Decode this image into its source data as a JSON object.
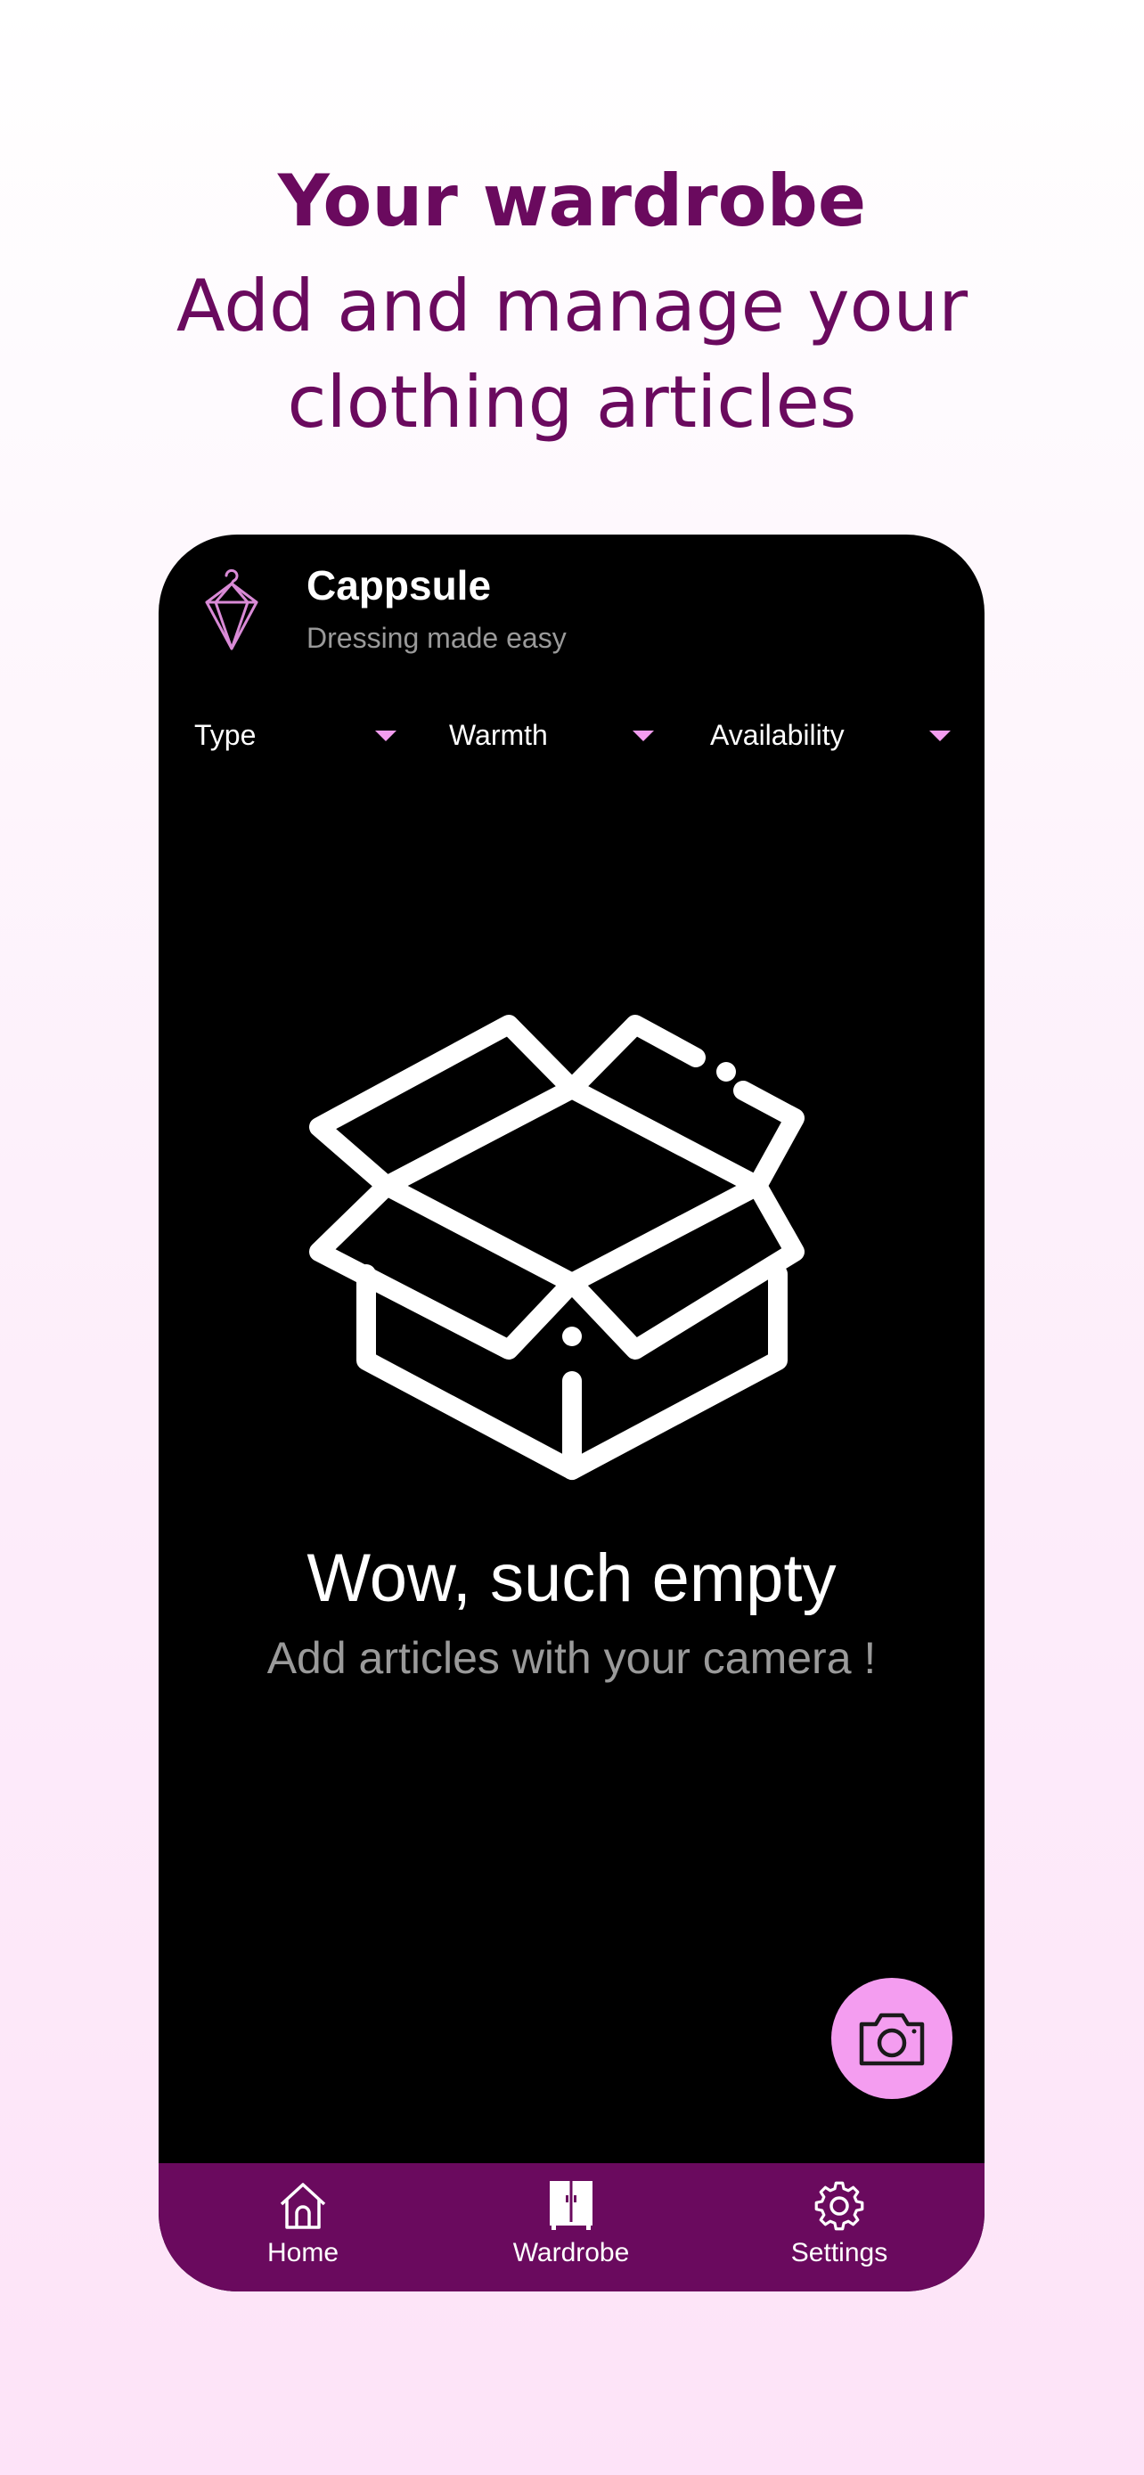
{
  "promo": {
    "title": "Your wardrobe",
    "subtitle": "Add and manage your clothing articles"
  },
  "app": {
    "name": "Cappsule",
    "tagline": "Dressing made easy",
    "logo_icon": "hanger-diamond-icon"
  },
  "filters": [
    {
      "label": "Type",
      "icon": "dropdown-caret-icon"
    },
    {
      "label": "Warmth",
      "icon": "dropdown-caret-icon"
    },
    {
      "label": "Availability",
      "icon": "dropdown-caret-icon"
    }
  ],
  "empty_state": {
    "icon": "open-box-icon",
    "title": "Wow, such empty",
    "hint": "Add articles with your camera !"
  },
  "fab": {
    "icon": "camera-icon"
  },
  "bottom_nav": {
    "items": [
      {
        "label": "Home",
        "icon": "home-icon"
      },
      {
        "label": "Wardrobe",
        "icon": "wardrobe-icon",
        "active": true
      },
      {
        "label": "Settings",
        "icon": "gear-icon"
      }
    ]
  },
  "colors": {
    "brand_purple": "#6a0a5e",
    "accent_pink": "#f49df0",
    "screen_background": "#000000",
    "secondary_text": "#9a9a9a"
  }
}
